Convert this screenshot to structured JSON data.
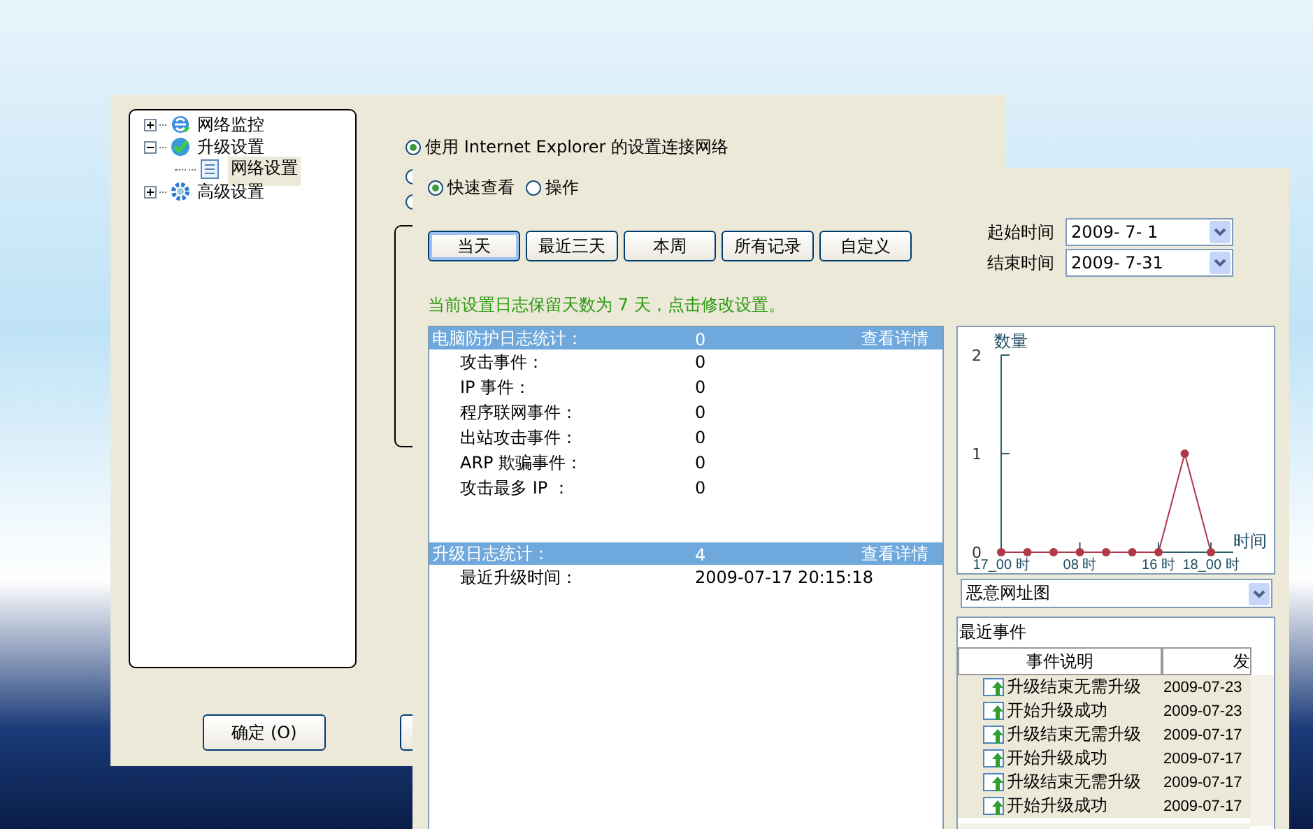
{
  "settings_window": {
    "tree": [
      {
        "label": "网络监控",
        "kind": "web",
        "expanded": false,
        "selected": false
      },
      {
        "label": "升级设置",
        "kind": "update",
        "expanded": true,
        "selected": false,
        "children": [
          {
            "label": "网络设置",
            "kind": "page",
            "selected": true
          }
        ]
      },
      {
        "label": "高级设置",
        "kind": "gear",
        "expanded": false,
        "selected": false
      }
    ],
    "radios": [
      {
        "label": "使用 Internet Explorer 的设置连接网络",
        "selected": true
      },
      {
        "selected": false
      },
      {
        "selected": false
      }
    ],
    "buttons": [
      "确定 (O)"
    ]
  },
  "log_window": {
    "view_modes": [
      {
        "label": "快速查看",
        "selected": true
      },
      {
        "label": "操作",
        "selected": false
      }
    ],
    "range_buttons": [
      {
        "label": "当天",
        "selected": true
      },
      {
        "label": "最近三天",
        "selected": false
      },
      {
        "label": "本周",
        "selected": false
      },
      {
        "label": "所有记录",
        "selected": false
      },
      {
        "label": "自定义",
        "selected": false
      }
    ],
    "start_time": {
      "label": "起始时间",
      "value": "2009- 7- 1"
    },
    "end_time": {
      "label": "结束时间",
      "value": "2009- 7-31"
    },
    "retention_notice": "当前设置日志保留天数为 7 天，点击修改设置。",
    "stats_sections": [
      {
        "title": "电脑防护日志统计：",
        "count": "0",
        "link": "查看详情",
        "rows": [
          {
            "label": "攻击事件：",
            "value": "0"
          },
          {
            "label": "IP 事件：",
            "value": "0"
          },
          {
            "label": "程序联网事件：",
            "value": "0"
          },
          {
            "label": "出站攻击事件：",
            "value": "0"
          },
          {
            "label": "ARP 欺骗事件：",
            "value": "0"
          },
          {
            "label": "攻击最多 IP ：",
            "value": "0"
          }
        ]
      },
      {
        "title": "升级日志统计：",
        "count": "4",
        "link": "查看详情",
        "rows": [
          {
            "label": "最近升级时间：",
            "value": "2009-07-17 20:15:18"
          }
        ]
      }
    ],
    "chart_data": {
      "type": "line",
      "xlabel": "时间",
      "ylabel": "数量",
      "categories": [
        "17_00 时",
        null,
        null,
        "08 时",
        null,
        null,
        "16 时",
        null,
        "18_00 时"
      ],
      "series": [
        {
          "color": "#b03848",
          "marker": "circle",
          "values": [
            0,
            0,
            0,
            0,
            0,
            0,
            0,
            1,
            0
          ]
        }
      ],
      "ylim": [
        0,
        2
      ],
      "yticks": [
        0,
        1,
        2
      ]
    },
    "chart_selector": {
      "value": "恶意网址图"
    },
    "recent_events": {
      "title": "最近事件",
      "columns": [
        "事件说明",
        "发"
      ],
      "rows": [
        {
          "description": "升级结束无需升级",
          "time": "2009-07-23"
        },
        {
          "description": "开始升级成功",
          "time": "2009-07-23"
        },
        {
          "description": "升级结束无需升级",
          "time": "2009-07-17"
        },
        {
          "description": "开始升级成功",
          "time": "2009-07-17"
        },
        {
          "description": "升级结束无需升级",
          "time": "2009-07-17"
        },
        {
          "description": "开始升级成功",
          "time": "2009-07-17"
        }
      ]
    }
  }
}
